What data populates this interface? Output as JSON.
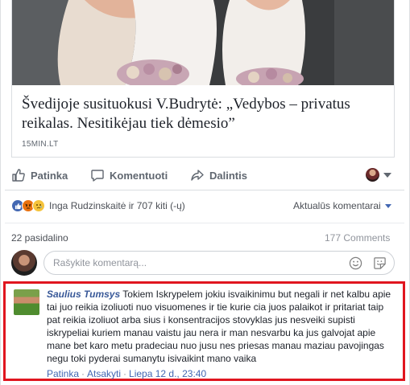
{
  "link_preview": {
    "title": "Švedijoje susituokusi V.Budrytė: „Vedybos – privatus reikalas. Nesitikėjau tiek dėmesio”",
    "source": "15MIN.LT"
  },
  "actions": {
    "like": "Patinka",
    "comment": "Komentuoti",
    "share": "Dalintis"
  },
  "reactions": {
    "summary": "Inga Rudzinskaitė ir 707 kiti (-ų)",
    "sort_label": "Aktualūs komentarai"
  },
  "stats": {
    "shares": "22 pasidalino",
    "comments": "177 Comments"
  },
  "composer": {
    "placeholder": "Rašykite komentarą..."
  },
  "comment": {
    "author": "Saulius Tumsys",
    "text": "Tokiem Iskrypelem jokiu isvaikinimu but negali ir net kalbu apie tai juo reikia izoliuoti nuo visuomenes ir tie kurie cia juos palaikot ir pritariat taip pat reikia izoliuot arba sius i konsentracijos stovyklas jus nesveiki supisti iskrypeliai kuriem manau vaistu jau nera ir man nesvarbu ka jus galvojat apie mane bet karo metu pradeciau nuo jusu nes priesas manau maziau pavojingas negu toki pyderai sumanytu isivaikint mano vaika",
    "like": "Patinka",
    "separator": "·",
    "reply": "Atsakyti",
    "time": "Liepa 12 d., 23:40"
  },
  "colors": {
    "link": "#4267b2",
    "highlight_border": "#e0161f",
    "muted": "#90949c"
  }
}
